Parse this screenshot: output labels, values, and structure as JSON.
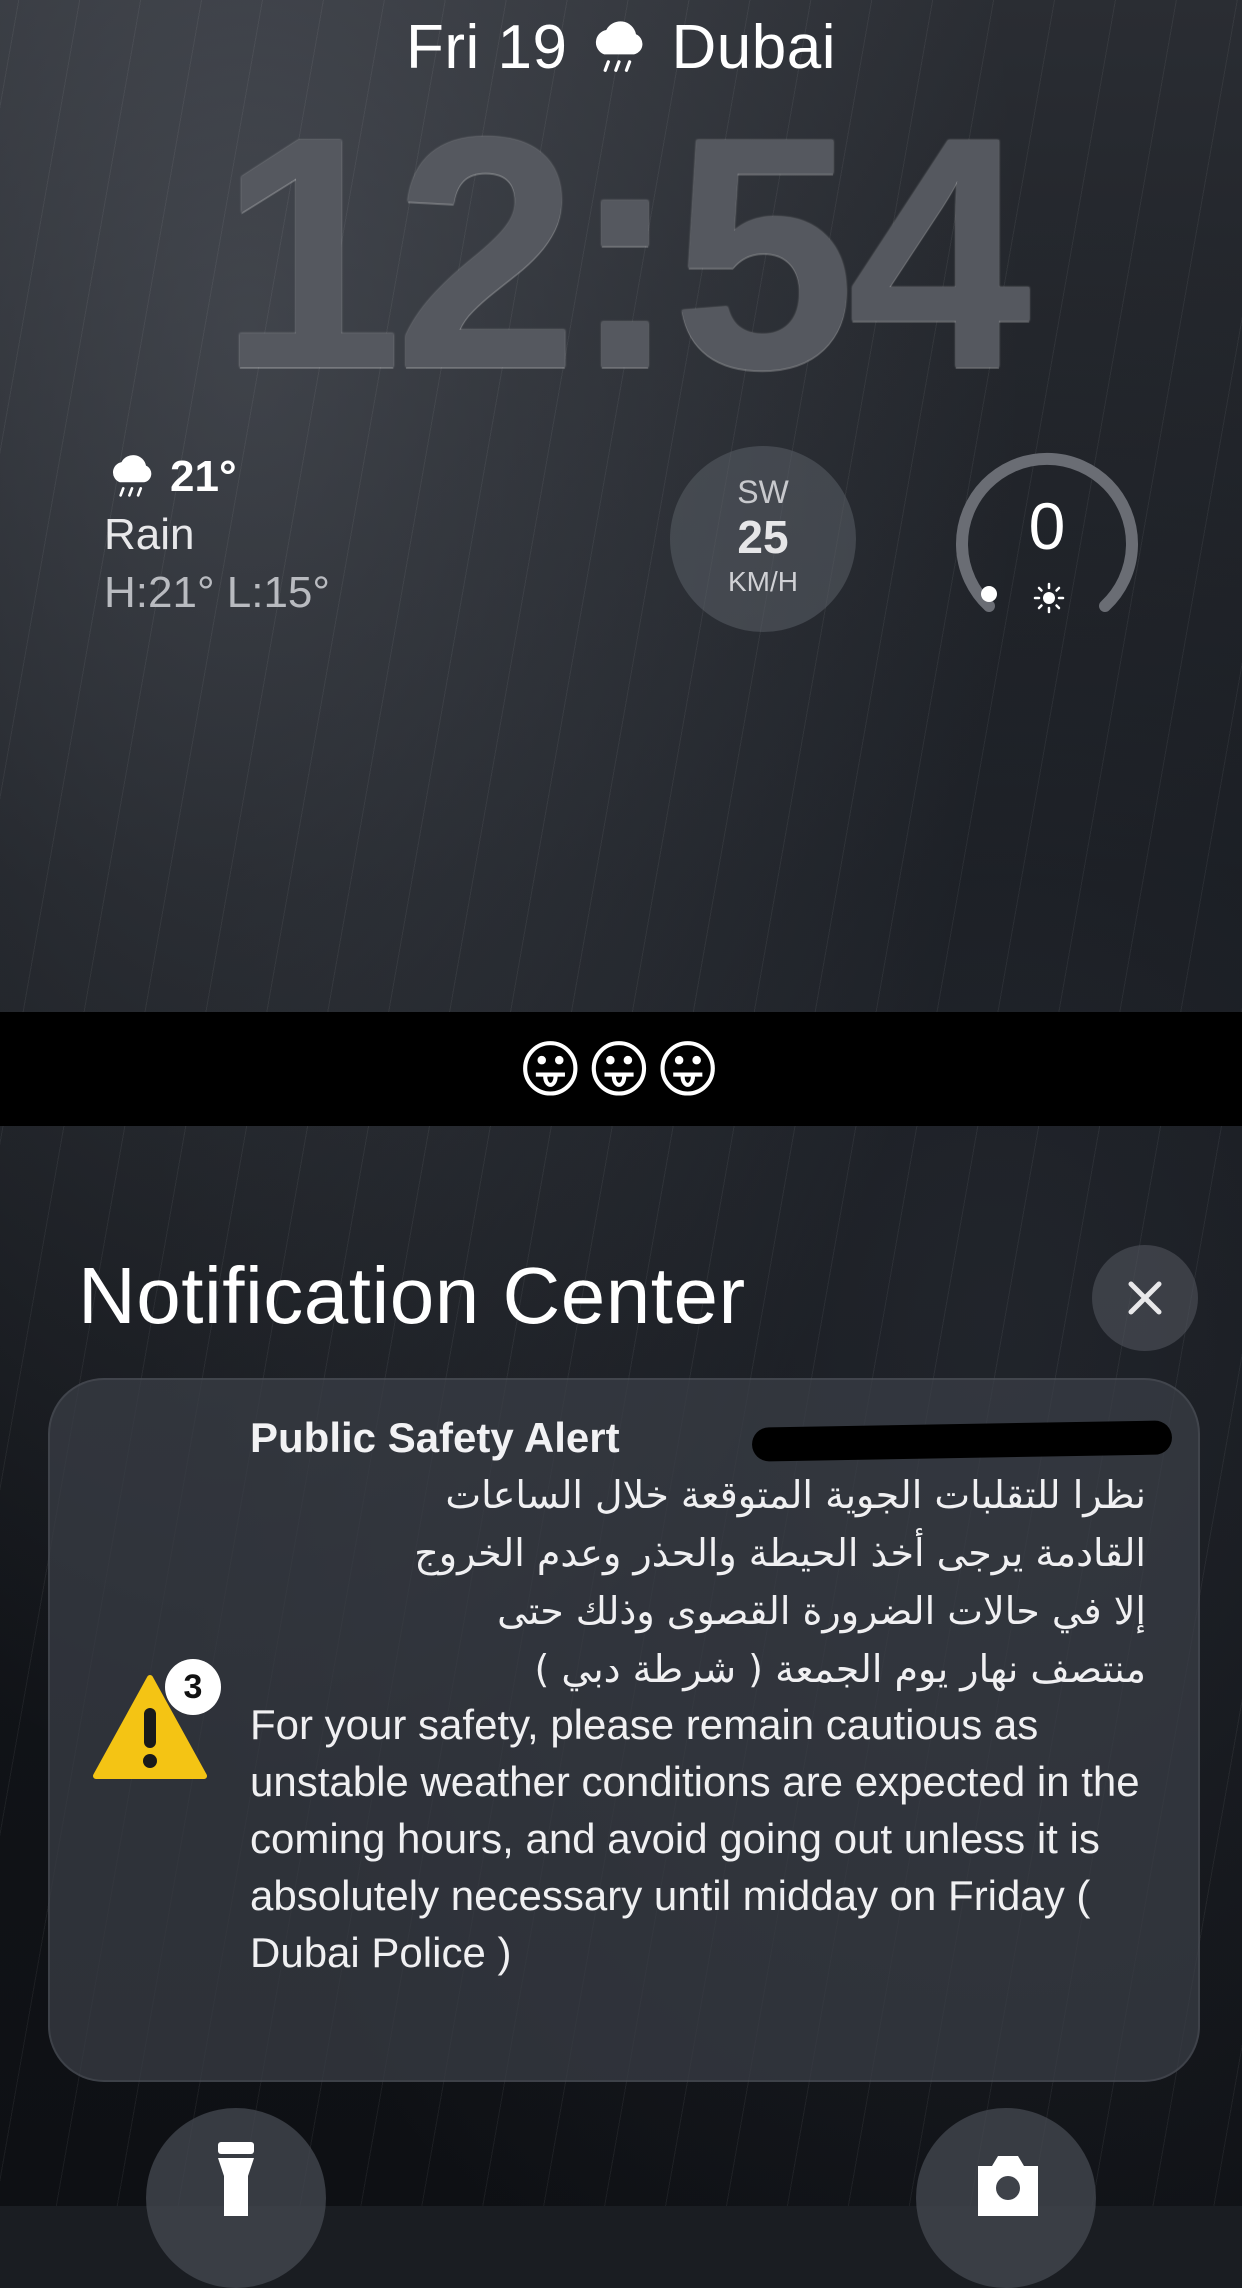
{
  "lockscreen": {
    "date": "Fri 19",
    "weather_icon": "rain-cloud-icon",
    "city": "Dubai",
    "time": "12:54"
  },
  "weather_widget": {
    "temp": "21°",
    "condition": "Rain",
    "high_low": "H:21° L:15°"
  },
  "wind_widget": {
    "direction": "SW",
    "speed": "25",
    "unit": "KM/H"
  },
  "uv_widget": {
    "value": "0",
    "icon": "sun-icon"
  },
  "emoji_band": "😛😛😛",
  "notification_center": {
    "title": "Notification Center",
    "close_icon": "close-icon"
  },
  "notification": {
    "app": "Public Safety Alert",
    "badge_count": "3",
    "icon": "warning-triangle-icon",
    "arabic_text": "نظرا للتقلبات الجوية المتوقعة خلال الساعات\nالقادمة يرجى أخذ الحيطة والحذر وعدم الخروج\nإلا في حالات الضرورة  القصوى وذلك حتى\nمنتصف نهار يوم الجمعة ( شرطة دبي )",
    "english_text": "For your safety, please remain cautious as unstable weather conditions are expected in the coming hours, and avoid going out unless it is absolutely necessary until midday on Friday ( Dubai Police  )"
  },
  "quick_actions": {
    "left_icon": "flashlight-icon",
    "right_icon": "camera-icon"
  }
}
